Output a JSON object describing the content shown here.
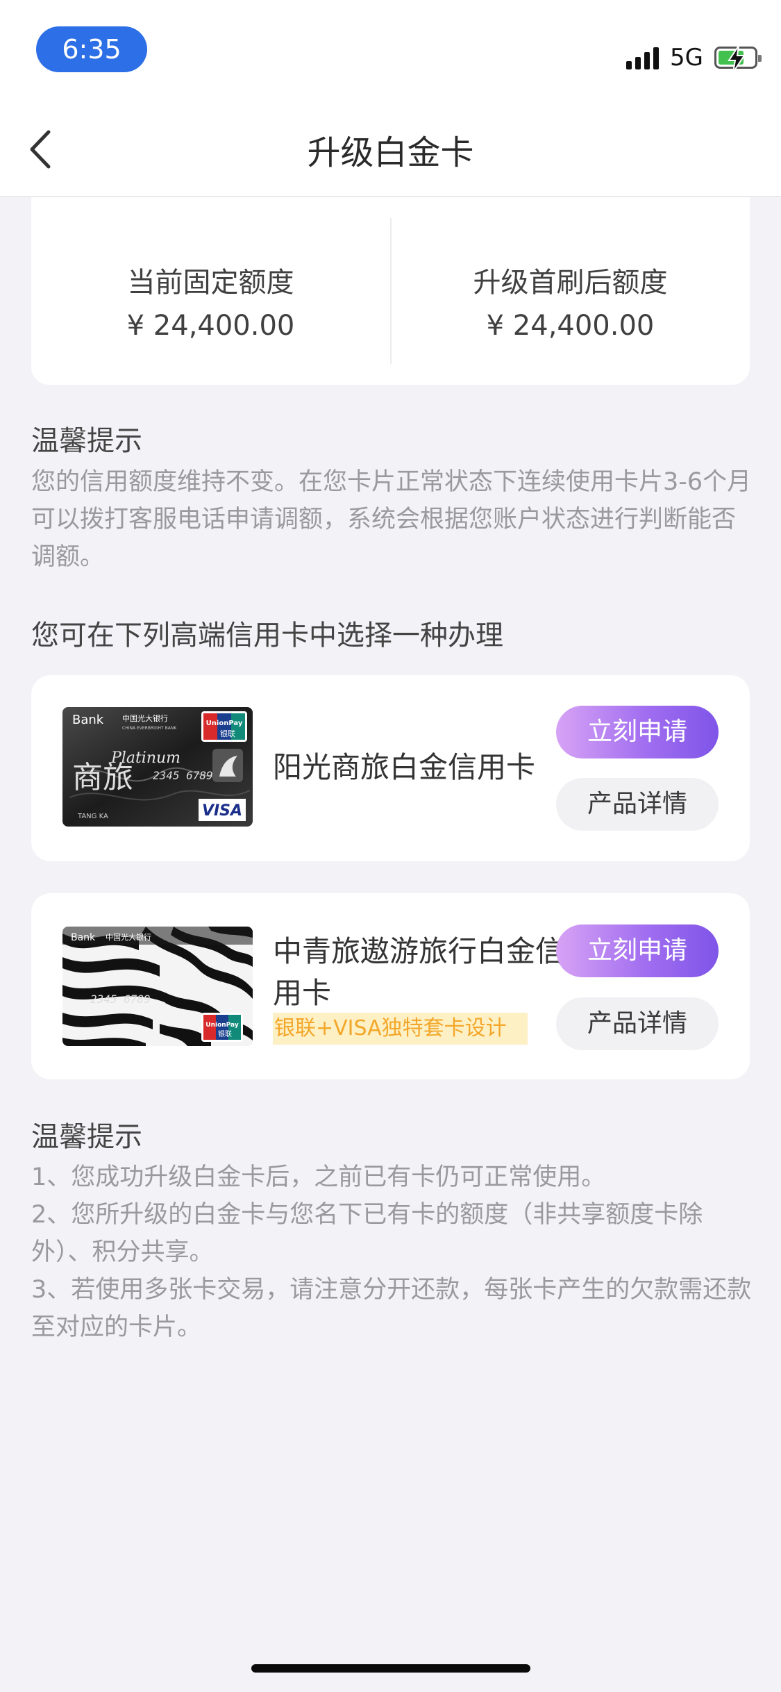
{
  "status_bar": {
    "time": "6:35",
    "network": "5G"
  },
  "nav": {
    "title": "升级白金卡"
  },
  "limits": {
    "current_label": "当前固定额度",
    "current_value": "¥ 24,400.00",
    "upgraded_label": "升级首刷后额度",
    "upgraded_value": "¥ 24,400.00"
  },
  "tip1": {
    "title": "温馨提示",
    "text": "您的信用额度维持不变。在您卡片正常状态下连续使用卡片3-6个月可以拨打客服电话申请调额，系统会根据您账户状态进行判断能否调额。"
  },
  "choose_heading": "您可在下列高端信用卡中选择一种办理",
  "cards": [
    {
      "name": "阳光商旅白金信用卡",
      "badge": "",
      "apply_label": "立刻申请",
      "detail_label": "产品详情",
      "image": {
        "bank_text": "Bank",
        "bank_cn": "中国光大银行",
        "bank_en": "CHINA EVERBRIGHT BANK",
        "unionpay": "UnionPay",
        "unionpay_cn": "银联",
        "platinum": "Platinum",
        "number": "2345  6789",
        "holder": "TANG KA",
        "visa": "VISA"
      }
    },
    {
      "name": "中青旅遨游旅行白金信用卡",
      "badge": "银联+VISA独特套卡设计",
      "apply_label": "立刻申请",
      "detail_label": "产品详情",
      "image": {
        "bank_text": "Bank",
        "bank_cn": "中国光大银行",
        "number": "2345  6789",
        "unionpay": "UnionPay",
        "unionpay_cn": "银联"
      }
    }
  ],
  "tip2": {
    "title": "温馨提示",
    "items": [
      "1、您成功升级白金卡后，之前已有卡仍可正常使用。",
      "2、您所升级的白金卡与您名下已有卡的额度（非共享额度卡除外）、积分共享。",
      "3、若使用多张卡交易，请注意分开还款，每张卡产生的欠款需还款至对应的卡片。"
    ]
  },
  "colors": {
    "accent_start": "#d7a3f5",
    "accent_end": "#7f55e8",
    "background": "#f3f3f7",
    "time_pill": "#2d6fe6"
  },
  "icons": [
    "back-chevron-icon",
    "signal-icon",
    "battery-charging-icon"
  ]
}
